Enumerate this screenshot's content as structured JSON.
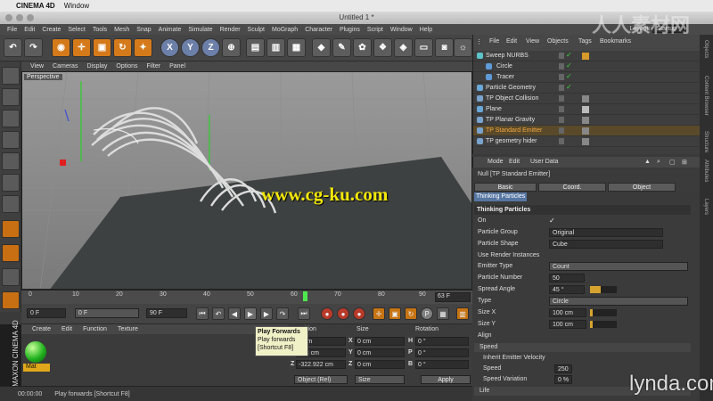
{
  "mac_menu": {
    "app": "CINEMA 4D",
    "window": "Window"
  },
  "title": "Untitled 1 *",
  "app_menu": [
    "File",
    "Edit",
    "Create",
    "Select",
    "Tools",
    "Mesh",
    "Snap",
    "Animate",
    "Simulate",
    "Render",
    "Sculpt",
    "MoGraph",
    "Character",
    "Plugins",
    "Script",
    "Window",
    "Help"
  ],
  "layout": {
    "label": "Layout:",
    "value": "Startup"
  },
  "toolbar": {
    "x": "X",
    "y": "Y",
    "z": "Z"
  },
  "viewport": {
    "menu": [
      "View",
      "Cameras",
      "Display",
      "Options",
      "Filter",
      "Panel"
    ],
    "label": "Perspective",
    "watermark": "www.cg-ku.com"
  },
  "timeline": {
    "ticks": [
      "0",
      "10",
      "20",
      "30",
      "40",
      "50",
      "60",
      "70",
      "80",
      "90"
    ],
    "frame": "63 F"
  },
  "transport": {
    "start": "0 F",
    "cur": "0 F",
    "end": "90 F"
  },
  "tooltip": {
    "title": "Play Forwards",
    "line1": "Play forwards",
    "line2": "[Shortcut F8]"
  },
  "material": {
    "menu": [
      "Create",
      "Edit",
      "Function",
      "Texture"
    ],
    "mat_name": "Mat",
    "maxon": "MAXON CINEMA 4D"
  },
  "coords": {
    "headers": [
      "Position",
      "Size",
      "Rotation"
    ],
    "pos": [
      "0 cm",
      "868 cm",
      "-322.922 cm"
    ],
    "size": [
      "0 cm",
      "0 cm",
      "0 cm"
    ],
    "rot": [
      "0 °",
      "0 °",
      "0 °"
    ],
    "labels_pos": [
      "X",
      "Y",
      "Z"
    ],
    "labels_rot": [
      "H",
      "P",
      "B"
    ],
    "mode": "Object (Rel)",
    "size_mode": "Size",
    "apply": "Apply"
  },
  "status": {
    "time": "00:00:00",
    "msg": "Play forwards [Shortcut F8]"
  },
  "objects": {
    "menu": [
      "File",
      "Edit",
      "View",
      "Objects",
      "Tags",
      "Bookmarks"
    ],
    "items": [
      {
        "name": "Sweep NURBS",
        "indent": 0
      },
      {
        "name": "Circle",
        "indent": 1
      },
      {
        "name": "Tracer",
        "indent": 1
      },
      {
        "name": "Particle Geometry",
        "indent": 0
      },
      {
        "name": "TP Object Collision",
        "indent": 0
      },
      {
        "name": "Plane",
        "indent": 0
      },
      {
        "name": "TP Planar Gravity",
        "indent": 0
      },
      {
        "name": "TP Standard Emitter",
        "indent": 0,
        "selected": true
      },
      {
        "name": "TP geometry hider",
        "indent": 0
      }
    ]
  },
  "attributes": {
    "menu": [
      "Mode",
      "Edit",
      "User Data"
    ],
    "title": "Null [TP Standard Emitter]",
    "tabs": [
      "Basic",
      "Coord.",
      "Object"
    ],
    "badge": "Thinking Particles",
    "section": "Thinking Particles",
    "rows": [
      {
        "label": "On",
        "check": "✓"
      },
      {
        "label": "Particle Group",
        "value": "Original"
      },
      {
        "label": "Particle Shape",
        "value": "Cube"
      },
      {
        "label": "Use Render Instances",
        "check": ""
      },
      {
        "label": "Emitter Type",
        "value": "Count"
      },
      {
        "label": "Particle Number",
        "value": "50"
      },
      {
        "label": "Spread Angle",
        "value": "45 °"
      },
      {
        "label": "Type",
        "value": "Circle"
      },
      {
        "label": "Size X",
        "value": "100 cm"
      },
      {
        "label": "Size Y",
        "value": "100 cm"
      },
      {
        "label": "Align",
        "check": ""
      }
    ],
    "speed_label": "Speed",
    "speed_rows": [
      {
        "label": "Inherit Emitter Velocity",
        "check": ""
      },
      {
        "label": "Speed",
        "value": "250"
      },
      {
        "label": "Speed Variation",
        "value": "0 %"
      }
    ],
    "life_label": "Life"
  },
  "side_tabs": [
    "Objects",
    "Content Browser",
    "Structure",
    "Attributes",
    "Layers"
  ],
  "brand": {
    "lynda": "lynda.com",
    "corner": "人人素材网"
  }
}
